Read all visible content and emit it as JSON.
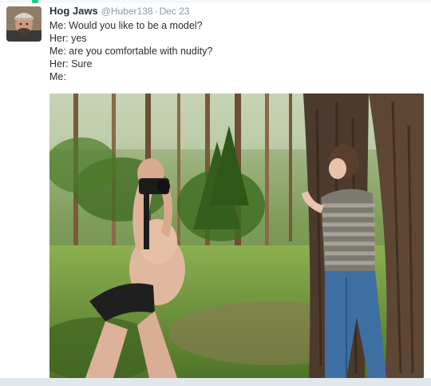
{
  "tweet": {
    "author_name": "Hog Jaws",
    "author_handle": "@Huber138",
    "separator": "·",
    "date": "Dec 23",
    "lines": [
      "Me: Would you like to be a model?",
      "Her: yes",
      "Me: are you comfortable with nudity?",
      "Her: Sure",
      "Me:"
    ]
  },
  "icons": {
    "avatar": "user-avatar-photo",
    "media": "forest-photo"
  },
  "colors": {
    "name_text": "#292f33",
    "meta_text": "#8899a6",
    "bar": "#e1e8ed",
    "top_mark": "#19cf86"
  }
}
